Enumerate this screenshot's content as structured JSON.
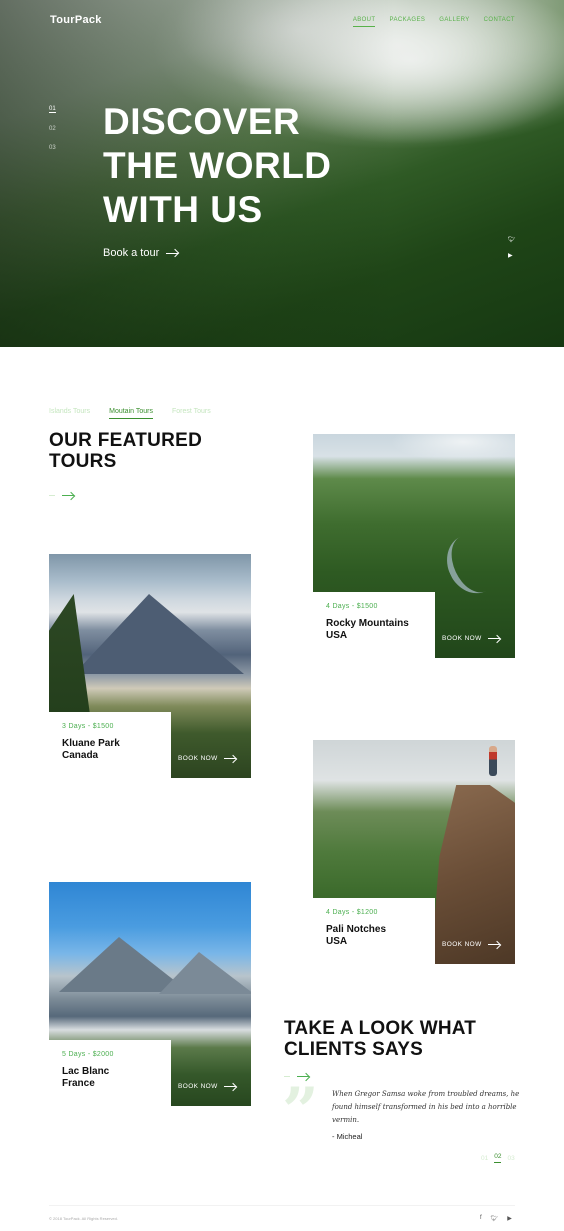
{
  "brand": "TourPack",
  "nav": [
    {
      "label": "ABOUT",
      "active": true
    },
    {
      "label": "PACKAGES",
      "active": false
    },
    {
      "label": "GALLERY",
      "active": false
    },
    {
      "label": "CONTACT",
      "active": false
    }
  ],
  "hero": {
    "slides": [
      "01",
      "02",
      "03"
    ],
    "title_lines": [
      "DISCOVER",
      "THE WORLD",
      "WITH US"
    ],
    "cta_label": "Book a tour"
  },
  "featured": {
    "tabs": [
      "Islands Tours",
      "Moutain Tours",
      "Forest Tours"
    ],
    "active_tab": "Moutain Tours",
    "title_lines": [
      "OUR FEATURED",
      "TOURS"
    ],
    "tours": [
      {
        "price": "4 Days - $1500",
        "name_lines": [
          "Rocky Mountains",
          "USA"
        ],
        "book_label": "BOOK NOW"
      },
      {
        "price": "3 Days - $1500",
        "name_lines": [
          "Kluane Park",
          "Canada"
        ],
        "book_label": "BOOK NOW"
      },
      {
        "price": "4 Days - $1200",
        "name_lines": [
          "Pali Notches",
          "USA"
        ],
        "book_label": "BOOK NOW"
      },
      {
        "price": "5 Days - $2000",
        "name_lines": [
          "Lac Blanc",
          "France"
        ],
        "book_label": "BOOK NOW"
      }
    ]
  },
  "testimonials": {
    "title_lines": [
      "TAKE A LOOK WHAT",
      "CLIENTS SAYS"
    ],
    "quote": "When Gregor Samsa woke from troubled dreams, he found himself transformed in his bed into a horrible vermin.",
    "author": "- Micheal",
    "pages": [
      "01",
      "02",
      "03"
    ],
    "active_page": "02"
  },
  "footer": {
    "copyright": "© 2018 TourPack. All Rights Reserved."
  },
  "colors": {
    "accent": "#4caf50",
    "accent_dark": "#3b8f2f",
    "tab_inactive": "#c5e6bf"
  },
  "icons": {
    "hero_social": [
      "twitter-icon",
      "youtube-icon"
    ],
    "footer_social": [
      "facebook-icon",
      "twitter-icon",
      "youtube-icon"
    ]
  }
}
